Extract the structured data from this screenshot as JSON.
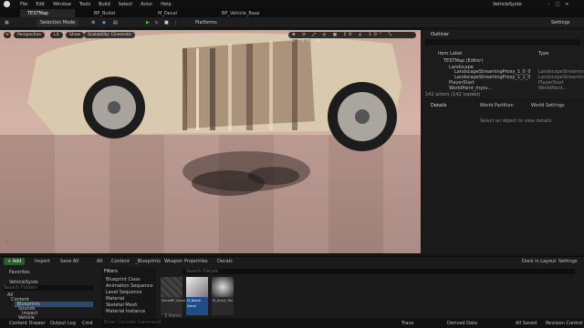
{
  "window": {
    "title": "VehicleSyste"
  },
  "menu": [
    "File",
    "Edit",
    "Window",
    "Tools",
    "Build",
    "Select",
    "Actor",
    "Help"
  ],
  "tabs": [
    {
      "label": "TESTMap",
      "active": true
    },
    {
      "label": "BP_Bullet",
      "active": false
    },
    {
      "label": "M_Decal",
      "active": false
    },
    {
      "label": "BP_Vehicle_Base",
      "active": false
    }
  ],
  "toolbar": {
    "mode": "Selection Mode",
    "platforms": "Platforms",
    "settings": "Settings"
  },
  "viewport": {
    "perspective": "Perspective",
    "lit": "Lit",
    "show": "Show",
    "scalability": "Scalability: Cinematic"
  },
  "outliner": {
    "title": "Outliner",
    "col_label": "Item Label",
    "col_type": "Type",
    "rows": [
      {
        "label": "TESTMap (Editor)",
        "type": ""
      },
      {
        "label": "Landscape",
        "type": ""
      },
      {
        "label": "LandscapeStreamingProxy_1_0_0",
        "type": "LandscapeStreamingPr"
      },
      {
        "label": "LandscapeStreamingProxy_1_1_0",
        "type": "LandscapeStreamingPr"
      },
      {
        "label": "PlayerStart",
        "type": "PlayerStart"
      },
      {
        "label": "WorldPaint_myss...",
        "type": "WorldPaint..."
      }
    ],
    "footer": "142 actors (142 loaded)"
  },
  "details": {
    "tabs": [
      "Details",
      "World Partition",
      "World Settings"
    ],
    "empty": "Select an object to view details."
  },
  "content": {
    "add": "+ Add",
    "import": "Import",
    "save_all": "Save All",
    "breadcrumb": [
      "All",
      "Content",
      "_Blueprints",
      "Weapon",
      "Projectiles",
      "Decals"
    ],
    "dock": "Dock in Layout",
    "settings": "Settings",
    "favorites": "Favorites",
    "root": "VehicleSyste",
    "search_folders": "Search Folders",
    "search_placeholder": "Search Decals",
    "filters_title": "Filters",
    "filters": [
      "Blueprint Class",
      "Animation Sequence",
      "Level Sequence",
      "Material",
      "Skeletal Mesh",
      "Material Instance"
    ],
    "tree": [
      "All",
      "Content",
      "_Blueprints",
      "Sounds",
      "Impact",
      "Vehicle"
    ],
    "assets": [
      {
        "name": "DecalBP_Decal_Bullet",
        "type": "Blueprint"
      },
      {
        "name": "M_Bullet Decal",
        "type": "Material"
      },
      {
        "name": "M_Decal_Tex",
        "type": "Texture"
      }
    ],
    "items_count": "3 items"
  },
  "status": {
    "content_drawer": "Content Drawer",
    "output_log": "Output Log",
    "cmd": "Cmd",
    "console_placeholder": "Enter Console Command",
    "trace": "Trace",
    "derived_data": "Derived Data",
    "all_saved": "All Saved",
    "revision": "Revision Control"
  }
}
